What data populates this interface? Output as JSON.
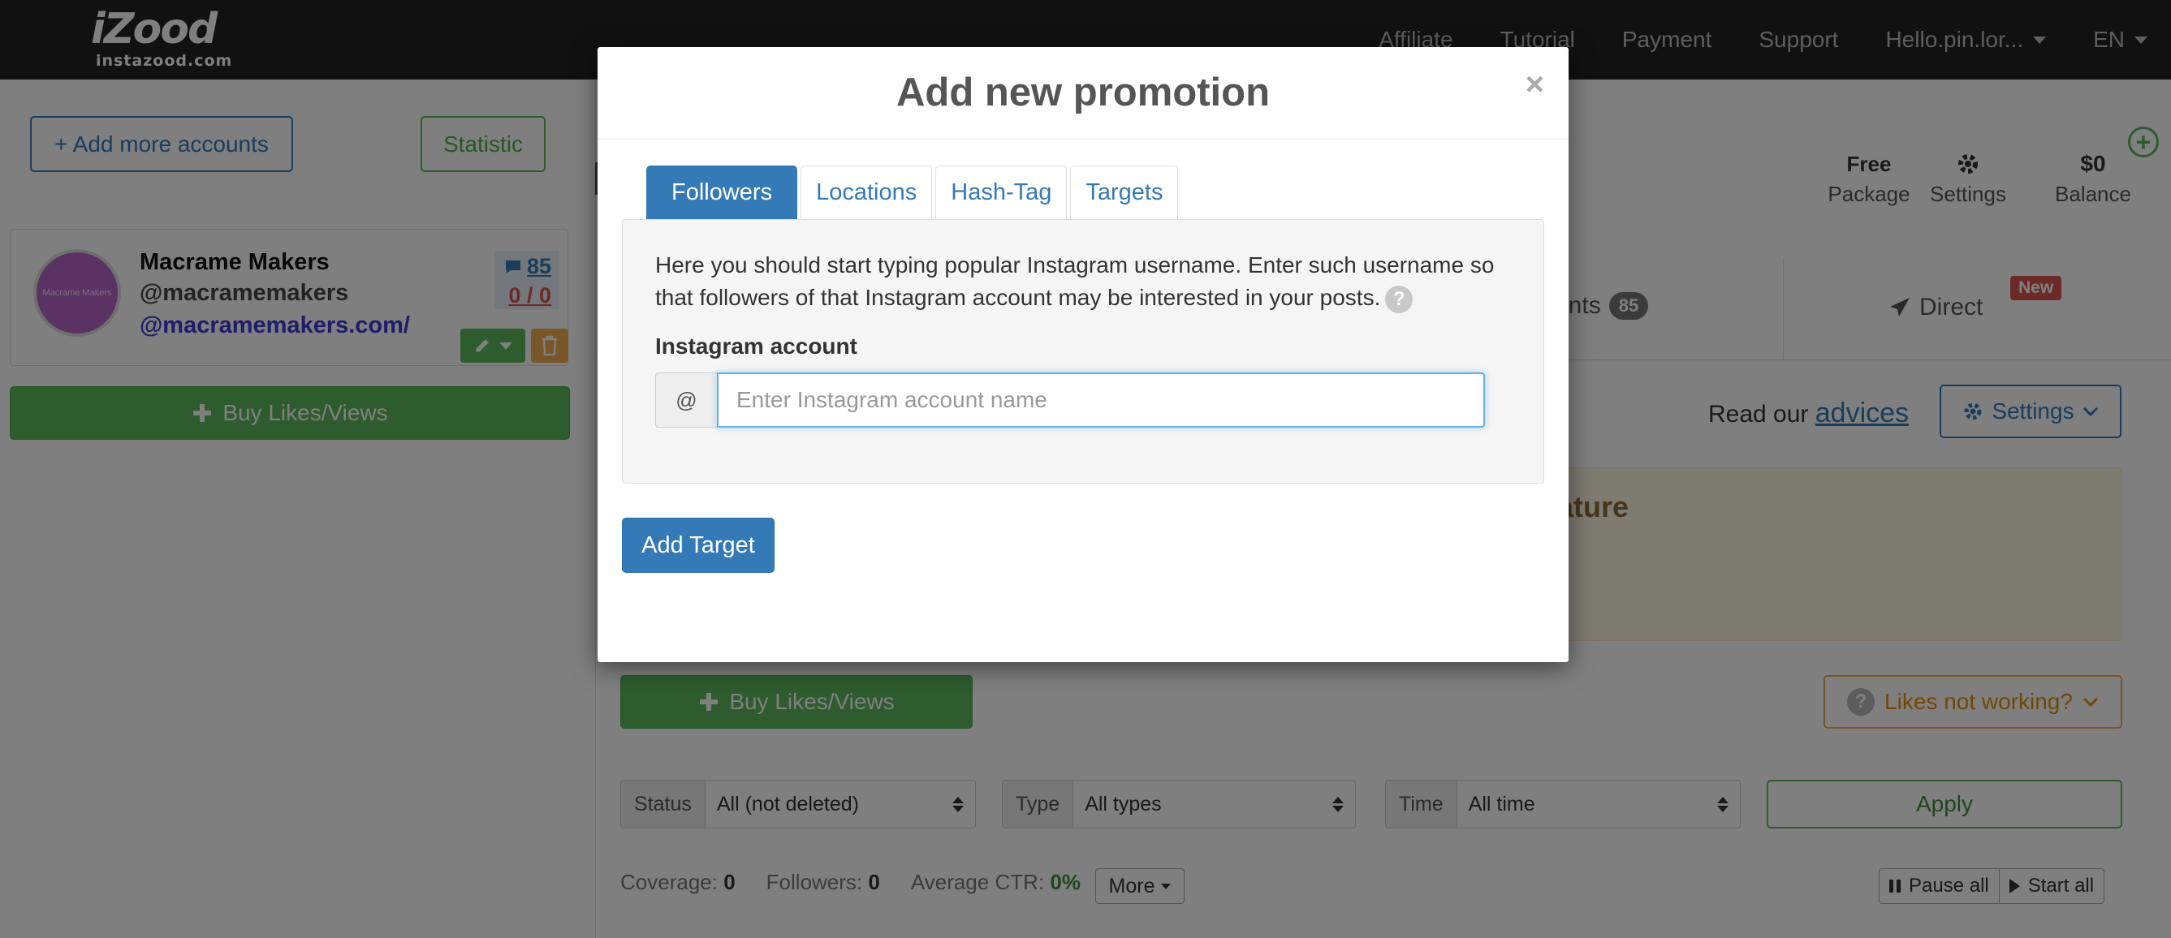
{
  "brand": {
    "logo_text": "iZood",
    "logo_sub": "instazood.com"
  },
  "nav": {
    "items": [
      "Affiliate",
      "Tutorial",
      "Payment",
      "Support"
    ],
    "user": "Hello.pin.lor...",
    "language": "EN"
  },
  "sidebar": {
    "add_accounts_label": "+ Add more accounts",
    "statistic_label": "Statistic",
    "account": {
      "avatar_text": "Macrame Makers",
      "name": "Macrame Makers",
      "handle": "@macramemakers",
      "link": "@macramemakers.com/",
      "comments": "85",
      "ratio": "0 / 0"
    },
    "buy_label": "Buy Likes/Views"
  },
  "header_stats": {
    "package_value": "Free",
    "package_label": "Package",
    "settings_label": "Settings",
    "balance_value": "$0",
    "balance_label": "Balance"
  },
  "main": {
    "tab_comments": "ments",
    "comments_badge": "85",
    "tab_direct": "Direct",
    "new_badge": "New",
    "read_our": "Read our",
    "advices": "advices",
    "settings_button": "Settings",
    "alert_partial": "ature",
    "buy_label": "Buy Likes/Views",
    "likes_not_working": "Likes not working?",
    "filters": {
      "status_label": "Status",
      "status_value": "All (not deleted)",
      "type_label": "Type",
      "type_value": "All types",
      "time_label": "Time",
      "time_value": "All time",
      "apply_label": "Apply"
    },
    "metrics": {
      "coverage_label": "Coverage:",
      "coverage_value": "0",
      "followers_label": "Followers:",
      "followers_value": "0",
      "ctr_label": "Average CTR:",
      "ctr_value": "0%"
    },
    "more_label": "More",
    "pause_all": "Pause all",
    "start_all": "Start all"
  },
  "modal": {
    "title": "Add new promotion",
    "close": "×",
    "tabs": [
      "Followers",
      "Locations",
      "Hash-Tag",
      "Targets"
    ],
    "active_tab": "Followers",
    "help_text": "Here you should start typing popular Instagram username. Enter such username so that followers of that Instagram account may be interested in your posts.",
    "field_label": "Instagram account",
    "addon": "@",
    "input_value": "",
    "input_placeholder": "Enter Instagram account name",
    "submit_label": "Add Target"
  },
  "colors": {
    "primary": "#337ab7",
    "success": "#5cb85c",
    "warning": "#f0ad4e",
    "danger": "#d9534f",
    "topbar": "#222222"
  }
}
